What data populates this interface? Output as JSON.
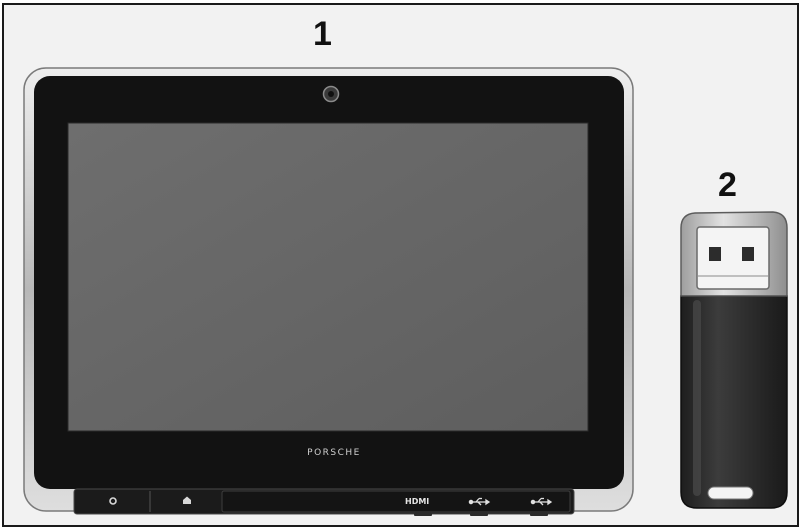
{
  "figure": {
    "callouts": [
      {
        "number": "1",
        "item": "tablet"
      },
      {
        "number": "2",
        "item": "usb-stick"
      }
    ]
  },
  "tablet": {
    "brand_logo_text": "PORSCHE",
    "buttons": [
      {
        "icon": "power-icon"
      },
      {
        "icon": "home-icon"
      }
    ],
    "ports": [
      {
        "label": "HDMI",
        "icon": "hdmi-port-icon"
      },
      {
        "label": "",
        "icon": "usb-icon"
      },
      {
        "label": "",
        "icon": "usb-icon"
      }
    ]
  },
  "colors": {
    "screen": "#6a6a6a",
    "bezel": "#121212",
    "frame_silver": "#c8c8c8",
    "usb_body": "#2e2e2e",
    "usb_cap": "#d0d0d0"
  }
}
